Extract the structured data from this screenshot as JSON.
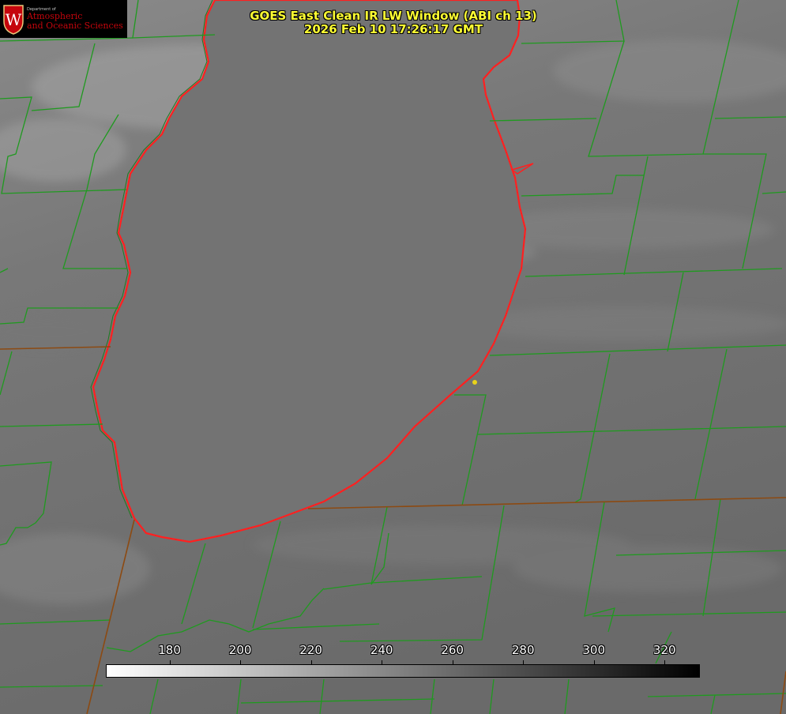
{
  "header": {
    "title_line1": "GOES East Clean IR LW Window (ABI ch 13)",
    "title_line2": "2026 Feb 10 17:26:17 GMT"
  },
  "logo": {
    "department": "Department of",
    "line1": "Atmospheric",
    "line2": "and Oceanic Sciences",
    "seal_letter": "W"
  },
  "colorbar": {
    "ticks": [
      "180",
      "200",
      "220",
      "240",
      "260",
      "280",
      "300",
      "320"
    ],
    "range": [
      162,
      330
    ],
    "color_cold": "#ffffff",
    "color_warm": "#000000"
  },
  "colors": {
    "county_lines": "#1f9a1f",
    "state_lines": "#8c4a12",
    "lake_shore": "#ff2020",
    "marker": "#e8d21a",
    "title_text": "#ffff33",
    "logo_red": "#c5050c"
  }
}
